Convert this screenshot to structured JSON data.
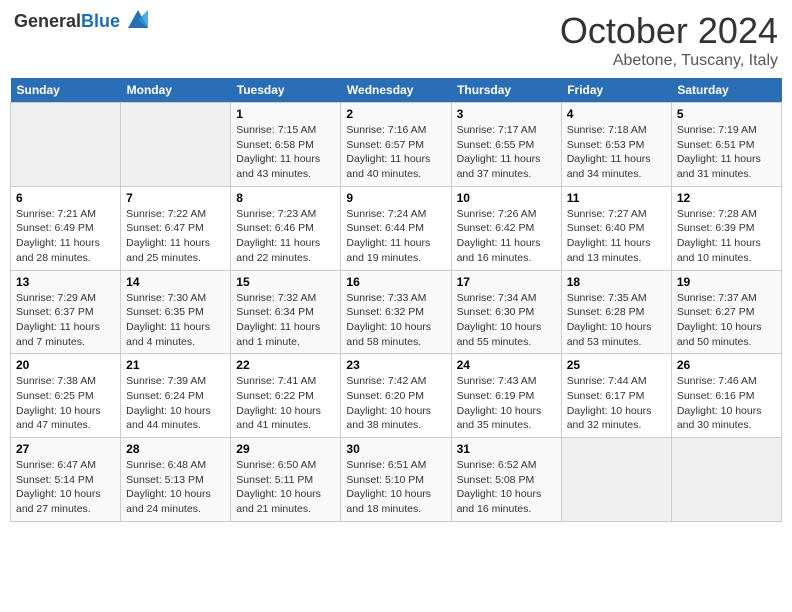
{
  "header": {
    "logo_general": "General",
    "logo_blue": "Blue",
    "title": "October 2024",
    "location": "Abetone, Tuscany, Italy"
  },
  "days_of_week": [
    "Sunday",
    "Monday",
    "Tuesday",
    "Wednesday",
    "Thursday",
    "Friday",
    "Saturday"
  ],
  "weeks": [
    [
      {
        "num": "",
        "info": ""
      },
      {
        "num": "",
        "info": ""
      },
      {
        "num": "1",
        "info": "Sunrise: 7:15 AM\nSunset: 6:58 PM\nDaylight: 11 hours and 43 minutes."
      },
      {
        "num": "2",
        "info": "Sunrise: 7:16 AM\nSunset: 6:57 PM\nDaylight: 11 hours and 40 minutes."
      },
      {
        "num": "3",
        "info": "Sunrise: 7:17 AM\nSunset: 6:55 PM\nDaylight: 11 hours and 37 minutes."
      },
      {
        "num": "4",
        "info": "Sunrise: 7:18 AM\nSunset: 6:53 PM\nDaylight: 11 hours and 34 minutes."
      },
      {
        "num": "5",
        "info": "Sunrise: 7:19 AM\nSunset: 6:51 PM\nDaylight: 11 hours and 31 minutes."
      }
    ],
    [
      {
        "num": "6",
        "info": "Sunrise: 7:21 AM\nSunset: 6:49 PM\nDaylight: 11 hours and 28 minutes."
      },
      {
        "num": "7",
        "info": "Sunrise: 7:22 AM\nSunset: 6:47 PM\nDaylight: 11 hours and 25 minutes."
      },
      {
        "num": "8",
        "info": "Sunrise: 7:23 AM\nSunset: 6:46 PM\nDaylight: 11 hours and 22 minutes."
      },
      {
        "num": "9",
        "info": "Sunrise: 7:24 AM\nSunset: 6:44 PM\nDaylight: 11 hours and 19 minutes."
      },
      {
        "num": "10",
        "info": "Sunrise: 7:26 AM\nSunset: 6:42 PM\nDaylight: 11 hours and 16 minutes."
      },
      {
        "num": "11",
        "info": "Sunrise: 7:27 AM\nSunset: 6:40 PM\nDaylight: 11 hours and 13 minutes."
      },
      {
        "num": "12",
        "info": "Sunrise: 7:28 AM\nSunset: 6:39 PM\nDaylight: 11 hours and 10 minutes."
      }
    ],
    [
      {
        "num": "13",
        "info": "Sunrise: 7:29 AM\nSunset: 6:37 PM\nDaylight: 11 hours and 7 minutes."
      },
      {
        "num": "14",
        "info": "Sunrise: 7:30 AM\nSunset: 6:35 PM\nDaylight: 11 hours and 4 minutes."
      },
      {
        "num": "15",
        "info": "Sunrise: 7:32 AM\nSunset: 6:34 PM\nDaylight: 11 hours and 1 minute."
      },
      {
        "num": "16",
        "info": "Sunrise: 7:33 AM\nSunset: 6:32 PM\nDaylight: 10 hours and 58 minutes."
      },
      {
        "num": "17",
        "info": "Sunrise: 7:34 AM\nSunset: 6:30 PM\nDaylight: 10 hours and 55 minutes."
      },
      {
        "num": "18",
        "info": "Sunrise: 7:35 AM\nSunset: 6:28 PM\nDaylight: 10 hours and 53 minutes."
      },
      {
        "num": "19",
        "info": "Sunrise: 7:37 AM\nSunset: 6:27 PM\nDaylight: 10 hours and 50 minutes."
      }
    ],
    [
      {
        "num": "20",
        "info": "Sunrise: 7:38 AM\nSunset: 6:25 PM\nDaylight: 10 hours and 47 minutes."
      },
      {
        "num": "21",
        "info": "Sunrise: 7:39 AM\nSunset: 6:24 PM\nDaylight: 10 hours and 44 minutes."
      },
      {
        "num": "22",
        "info": "Sunrise: 7:41 AM\nSunset: 6:22 PM\nDaylight: 10 hours and 41 minutes."
      },
      {
        "num": "23",
        "info": "Sunrise: 7:42 AM\nSunset: 6:20 PM\nDaylight: 10 hours and 38 minutes."
      },
      {
        "num": "24",
        "info": "Sunrise: 7:43 AM\nSunset: 6:19 PM\nDaylight: 10 hours and 35 minutes."
      },
      {
        "num": "25",
        "info": "Sunrise: 7:44 AM\nSunset: 6:17 PM\nDaylight: 10 hours and 32 minutes."
      },
      {
        "num": "26",
        "info": "Sunrise: 7:46 AM\nSunset: 6:16 PM\nDaylight: 10 hours and 30 minutes."
      }
    ],
    [
      {
        "num": "27",
        "info": "Sunrise: 6:47 AM\nSunset: 5:14 PM\nDaylight: 10 hours and 27 minutes."
      },
      {
        "num": "28",
        "info": "Sunrise: 6:48 AM\nSunset: 5:13 PM\nDaylight: 10 hours and 24 minutes."
      },
      {
        "num": "29",
        "info": "Sunrise: 6:50 AM\nSunset: 5:11 PM\nDaylight: 10 hours and 21 minutes."
      },
      {
        "num": "30",
        "info": "Sunrise: 6:51 AM\nSunset: 5:10 PM\nDaylight: 10 hours and 18 minutes."
      },
      {
        "num": "31",
        "info": "Sunrise: 6:52 AM\nSunset: 5:08 PM\nDaylight: 10 hours and 16 minutes."
      },
      {
        "num": "",
        "info": ""
      },
      {
        "num": "",
        "info": ""
      }
    ]
  ]
}
